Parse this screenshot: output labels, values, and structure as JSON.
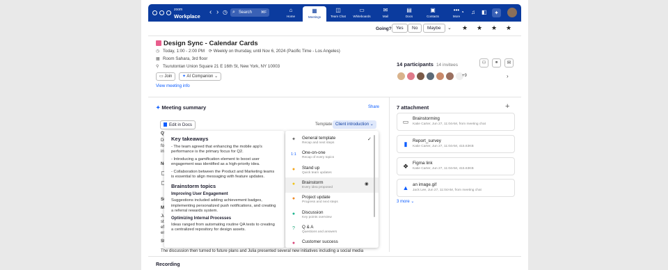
{
  "topbar": {
    "logo_small": "zoom",
    "logo_big": "Workplace",
    "search_placeholder": "Search",
    "search_shortcut": "⌘F",
    "nav": [
      {
        "label": "Home",
        "icon": "home-icon",
        "glyph": "⌂"
      },
      {
        "label": "Meetings",
        "icon": "calendar-icon",
        "glyph": "▦"
      },
      {
        "label": "Team Chat",
        "icon": "chat-icon",
        "glyph": "◫"
      },
      {
        "label": "Whiteboards",
        "icon": "whiteboard-icon",
        "glyph": "▭"
      },
      {
        "label": "Mail",
        "icon": "mail-icon",
        "glyph": "✉"
      },
      {
        "label": "Docs",
        "icon": "docs-icon",
        "glyph": "▤"
      },
      {
        "label": "Contacts",
        "icon": "contacts-icon",
        "glyph": "▣"
      },
      {
        "label": "More",
        "icon": "more-icon",
        "glyph": "•••"
      }
    ],
    "active_nav": "Meetings",
    "accent": "#0b3b9e"
  },
  "rsvp": {
    "label": "Going?",
    "options": [
      "Yes",
      "No",
      "Maybe"
    ]
  },
  "meeting": {
    "title": "Design Sync - Calendar Cards",
    "time": "Today, 1:00 - 2:00 PM",
    "recurrence": "Weekly on thursday, until Nov 6, 2024 (Pacific Time - Los Angeles)",
    "room": "Room Sahara, 3rd floor",
    "address": "Tsurutontan Union Square 21 E 16th St, New York, NY 10003",
    "join_label": "Join",
    "companion_label": "AI Companion",
    "view_info": "View meeting info"
  },
  "participants": {
    "count_label": "14 participants",
    "invitees_label": "14 invitees",
    "more_label": "+9"
  },
  "summary": {
    "heading": "Meeting summary",
    "share_label": "Share",
    "edit_docs_label": "Edit in Docs",
    "template_label": "Template:",
    "template_value": "Client introduction",
    "background_lines": [
      {
        "text": "Qui",
        "bold": true
      },
      {
        "text": "Durii",
        "bold": false
      },
      {
        "text": "focu",
        "bold": false
      },
      {
        "text": "inter",
        "bold": false
      },
      {
        "text": "Nex",
        "bold": true
      },
      {
        "text": "Sun",
        "bold": true
      },
      {
        "text": "Mar",
        "bold": true
      },
      {
        "text": "Julia",
        "bold": false
      },
      {
        "text": "strat",
        "bold": false
      },
      {
        "text": "effe",
        "bold": false
      },
      {
        "text": "enga",
        "bold": false
      },
      {
        "text": "Stat",
        "bold": true
      }
    ],
    "bottom_line": "The discussion then turned to future plans and Julia presented several new initiatives including a social media",
    "key_takeaways": {
      "title": "Key takeaways",
      "bullets": [
        "- The team agreed that enhancing the mobile app's performance is the primary focus for Q2.",
        "- Introducing a gamification element to boost user engagement was identified as a high-priority idea.",
        "- Collaboration between the Product and Marketing teams is essential to align messaging with feature updates."
      ],
      "topics_title": "Brainstorm topics",
      "topics": [
        {
          "title": "Improving User Engagement",
          "text": "Suggestions included adding achievement badges, implementing personalized push notifications, and creating a referral rewards system."
        },
        {
          "title": "Optimizing Internal Processes",
          "text": "Ideas ranged from automating routine QA tests to creating a centralized repository for design assets."
        }
      ]
    },
    "templates": [
      {
        "name": "General template",
        "desc": "Recap and next steps",
        "icon": "sparkle-icon",
        "glyph": "✦",
        "color": "#555"
      },
      {
        "name": "One-on-one",
        "desc": "Recap of every topics",
        "icon": "one-on-one-icon",
        "glyph": "1:1",
        "color": "#0b5cff"
      },
      {
        "name": "Stand up",
        "desc": "Quick team updates",
        "icon": "standup-icon",
        "glyph": "●",
        "color": "#f3a417"
      },
      {
        "name": "Brainstorm",
        "desc": "Every idea proposed",
        "icon": "brainstorm-icon",
        "glyph": "●",
        "color": "#f0c419"
      },
      {
        "name": "Project update",
        "desc": "Progress and next steps",
        "icon": "project-icon",
        "glyph": "●",
        "color": "#f08a24"
      },
      {
        "name": "Discussion",
        "desc": "Key points overview",
        "icon": "discussion-icon",
        "glyph": "●",
        "color": "#1fb58f"
      },
      {
        "name": "Q & A",
        "desc": "Questions and answers",
        "icon": "qa-icon",
        "glyph": "?",
        "color": "#1fa67a"
      },
      {
        "name": "Customer success",
        "desc": "",
        "icon": "customer-icon",
        "glyph": "●",
        "color": "#d9477a"
      }
    ]
  },
  "attachments": {
    "heading": "7 attachment",
    "items": [
      {
        "name": "Brainstorming",
        "meta": "Katie Carter, Jun 27, 11:04AM, from meeting chat",
        "icon": "whiteboard-file-icon",
        "glyph": "▭",
        "color": "#555"
      },
      {
        "name": "Report_survey",
        "meta": "Katie Carter, Jun 27, 11:04AM, 415.63KB",
        "icon": "doc-file-icon",
        "glyph": "▮",
        "color": "#0b5cff"
      },
      {
        "name": "Figma link",
        "meta": "Katie Carter, Jun 27, 11:04AM, 415.63KB",
        "icon": "figma-icon",
        "glyph": "❖",
        "color": "#222"
      },
      {
        "name": "an image.gif",
        "meta": "Jack Lee, Jun 27, 11:04AM, from meeting chat",
        "icon": "image-file-icon",
        "glyph": "▲",
        "color": "#0b5cff"
      }
    ],
    "more_label": "3 more"
  },
  "recording": {
    "heading": "Recording"
  }
}
